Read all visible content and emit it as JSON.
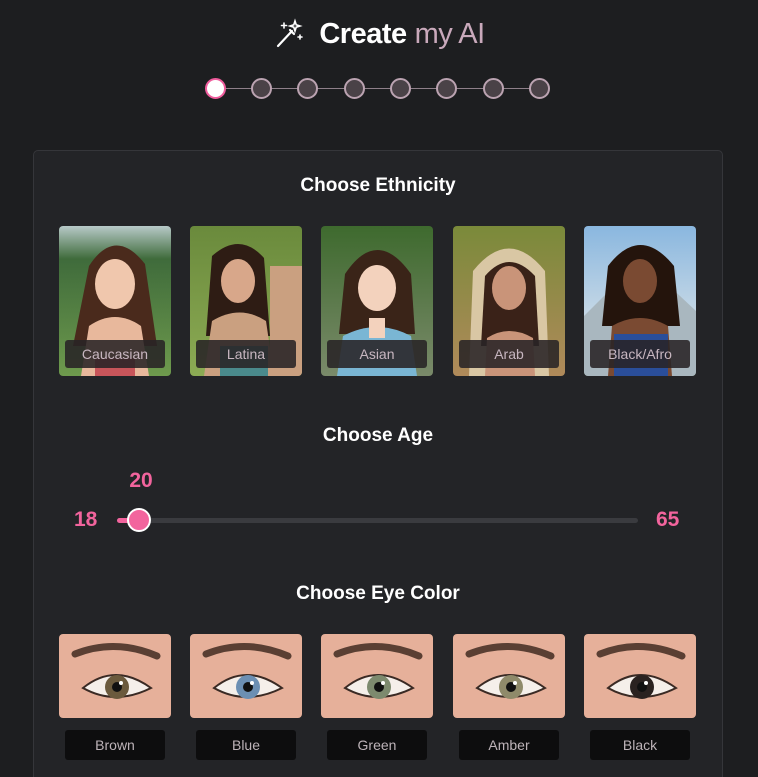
{
  "header": {
    "title_main": "Create",
    "title_accent": "my AI",
    "icon": "magic-wand-icon"
  },
  "stepper": {
    "total_steps": 8,
    "active_step": 1
  },
  "ethnicity": {
    "title": "Choose Ethnicity",
    "options": [
      {
        "label": "Caucasian"
      },
      {
        "label": "Latina"
      },
      {
        "label": "Asian"
      },
      {
        "label": "Arab"
      },
      {
        "label": "Black/Afro"
      }
    ]
  },
  "age": {
    "title": "Choose Age",
    "current": "20",
    "min": "18",
    "max": "65"
  },
  "eye_color": {
    "title": "Choose Eye Color",
    "options": [
      {
        "label": "Brown",
        "iris_color": "#6b5a3d"
      },
      {
        "label": "Blue",
        "iris_color": "#6c8fb3"
      },
      {
        "label": "Green",
        "iris_color": "#7d8a6e"
      },
      {
        "label": "Amber",
        "iris_color": "#8f8a6a"
      },
      {
        "label": "Black",
        "iris_color": "#2a2220"
      }
    ]
  },
  "colors": {
    "accent": "#f2649d",
    "background": "#1d1e20",
    "panel": "#232427"
  }
}
